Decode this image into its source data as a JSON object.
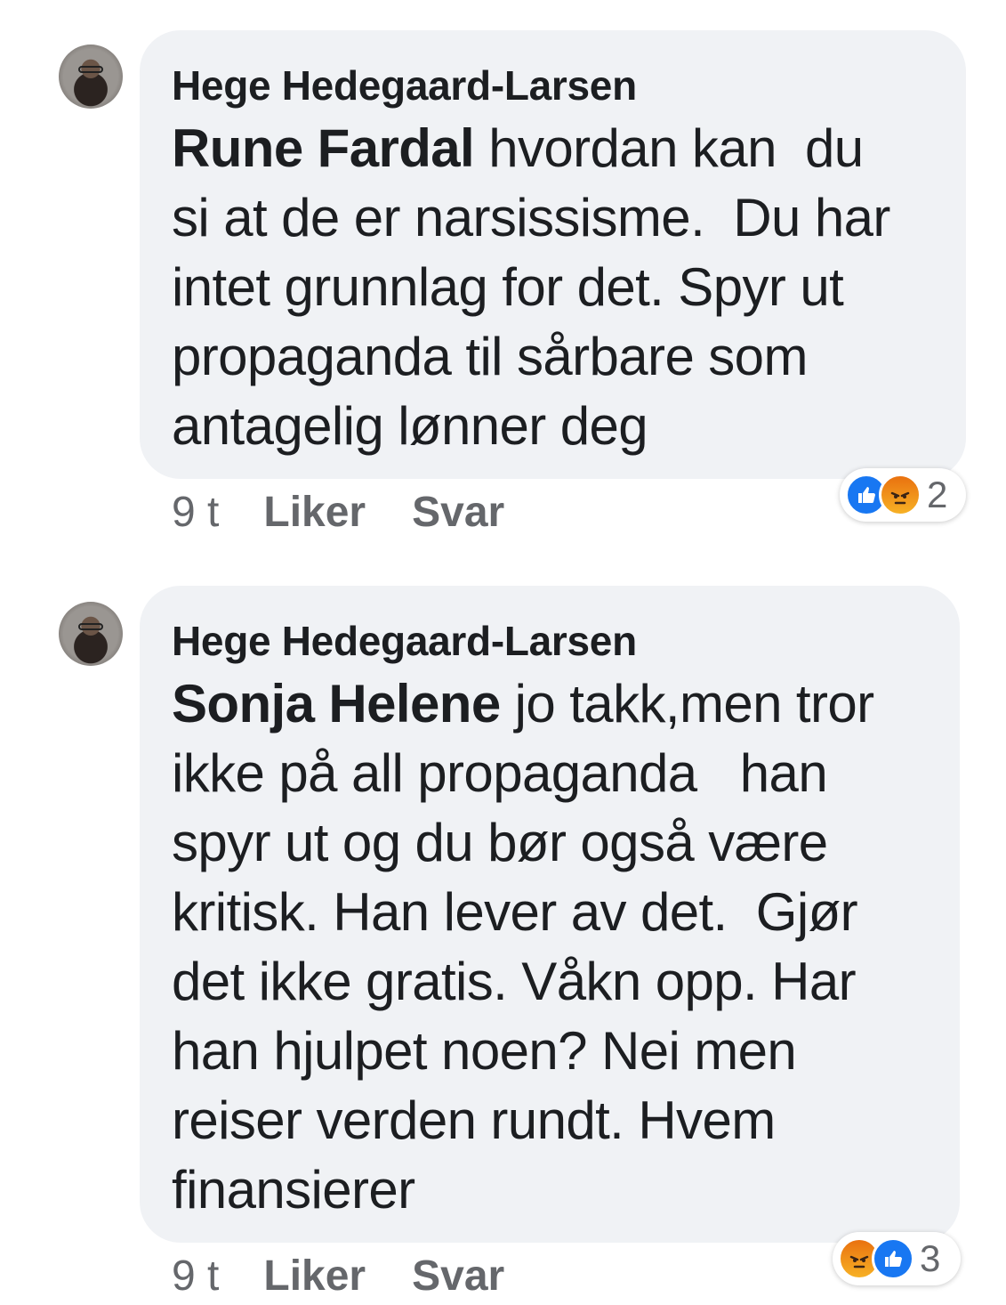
{
  "comments": [
    {
      "author": "Hege Hedegaard-Larsen",
      "tag": "Rune Fardal",
      "lines": [
        " hvordan kan  du",
        "si at de er narsissisme.  Du har",
        "intet grunnlag for det. Spyr ut",
        "propaganda til sårbare som",
        "antagelig lønner deg"
      ],
      "time": "9 t",
      "like_label": "Liker",
      "reply_label": "Svar",
      "reactions": [
        "like-icon",
        "angry-icon"
      ],
      "reaction_count": "2"
    },
    {
      "author": "Hege Hedegaard-Larsen",
      "tag": "Sonja Helene",
      "lines": [
        " jo takk,men tror",
        "ikke på all propaganda   han",
        "spyr ut og du bør også være",
        "kritisk. Han lever av det.  Gjør",
        "det ikke gratis. Våkn opp. Har",
        "han hjulpet noen? Nei men",
        "reiser verden rundt. Hvem",
        "finansierer"
      ],
      "time": "9 t",
      "like_label": "Liker",
      "reply_label": "Svar",
      "reactions": [
        "angry-icon",
        "like-icon"
      ],
      "reaction_count": "3"
    }
  ],
  "colors": {
    "bubble": "#f0f2f5",
    "text": "#1c1e21",
    "meta": "#65676b",
    "like": "#1877f2",
    "angry": "#e9710f"
  }
}
